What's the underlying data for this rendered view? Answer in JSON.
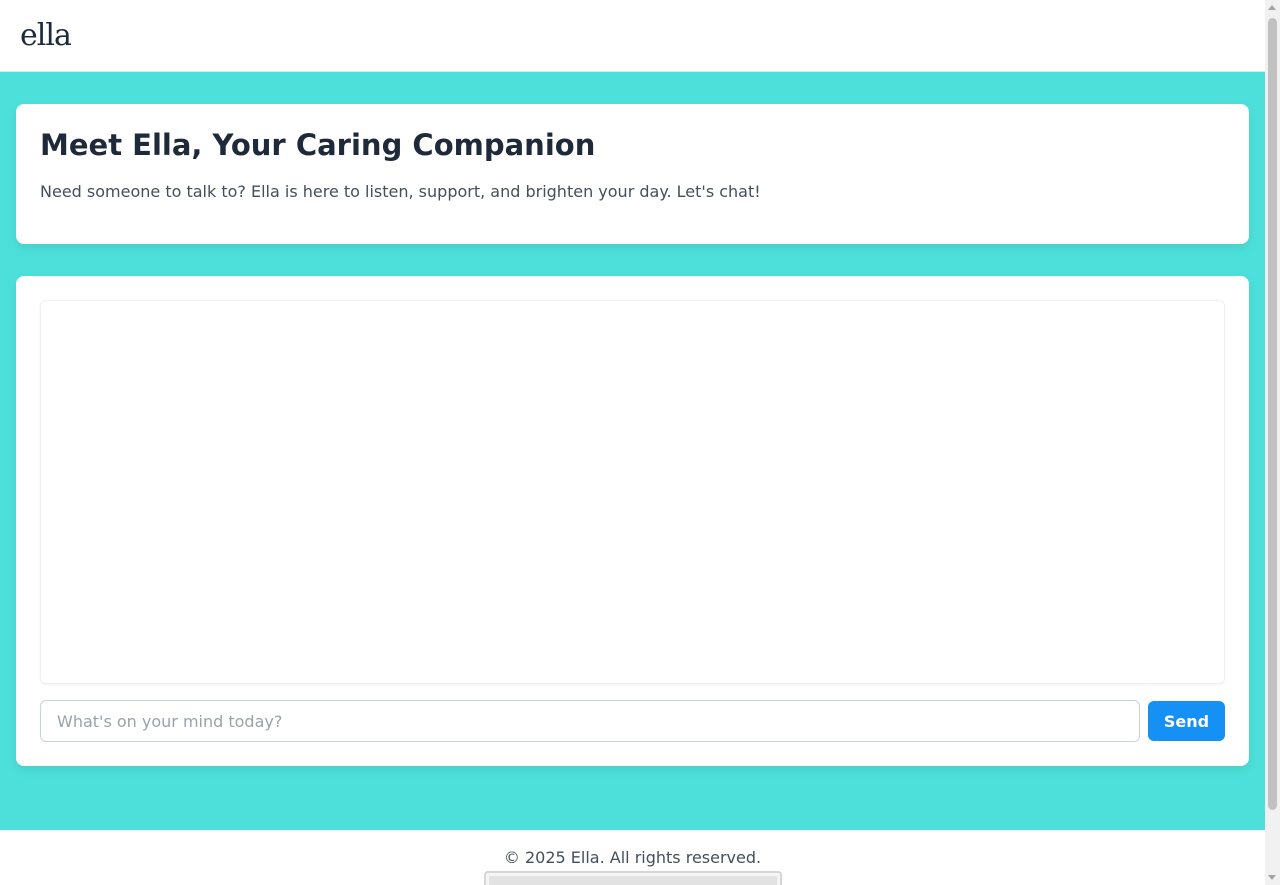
{
  "header": {
    "logo": "ella"
  },
  "intro": {
    "title": "Meet Ella, Your Caring Companion",
    "text": "Need someone to talk to? Ella is here to listen, support, and brighten your day. Let's chat!"
  },
  "chat": {
    "input_placeholder": "What's on your mind today?",
    "input_value": "",
    "send_label": "Send"
  },
  "footer": {
    "copyright": "© 2025 Ella. All rights reserved."
  },
  "colors": {
    "background": "#4de0da",
    "accent": "#1590f5",
    "heading": "#1e2a3a"
  }
}
